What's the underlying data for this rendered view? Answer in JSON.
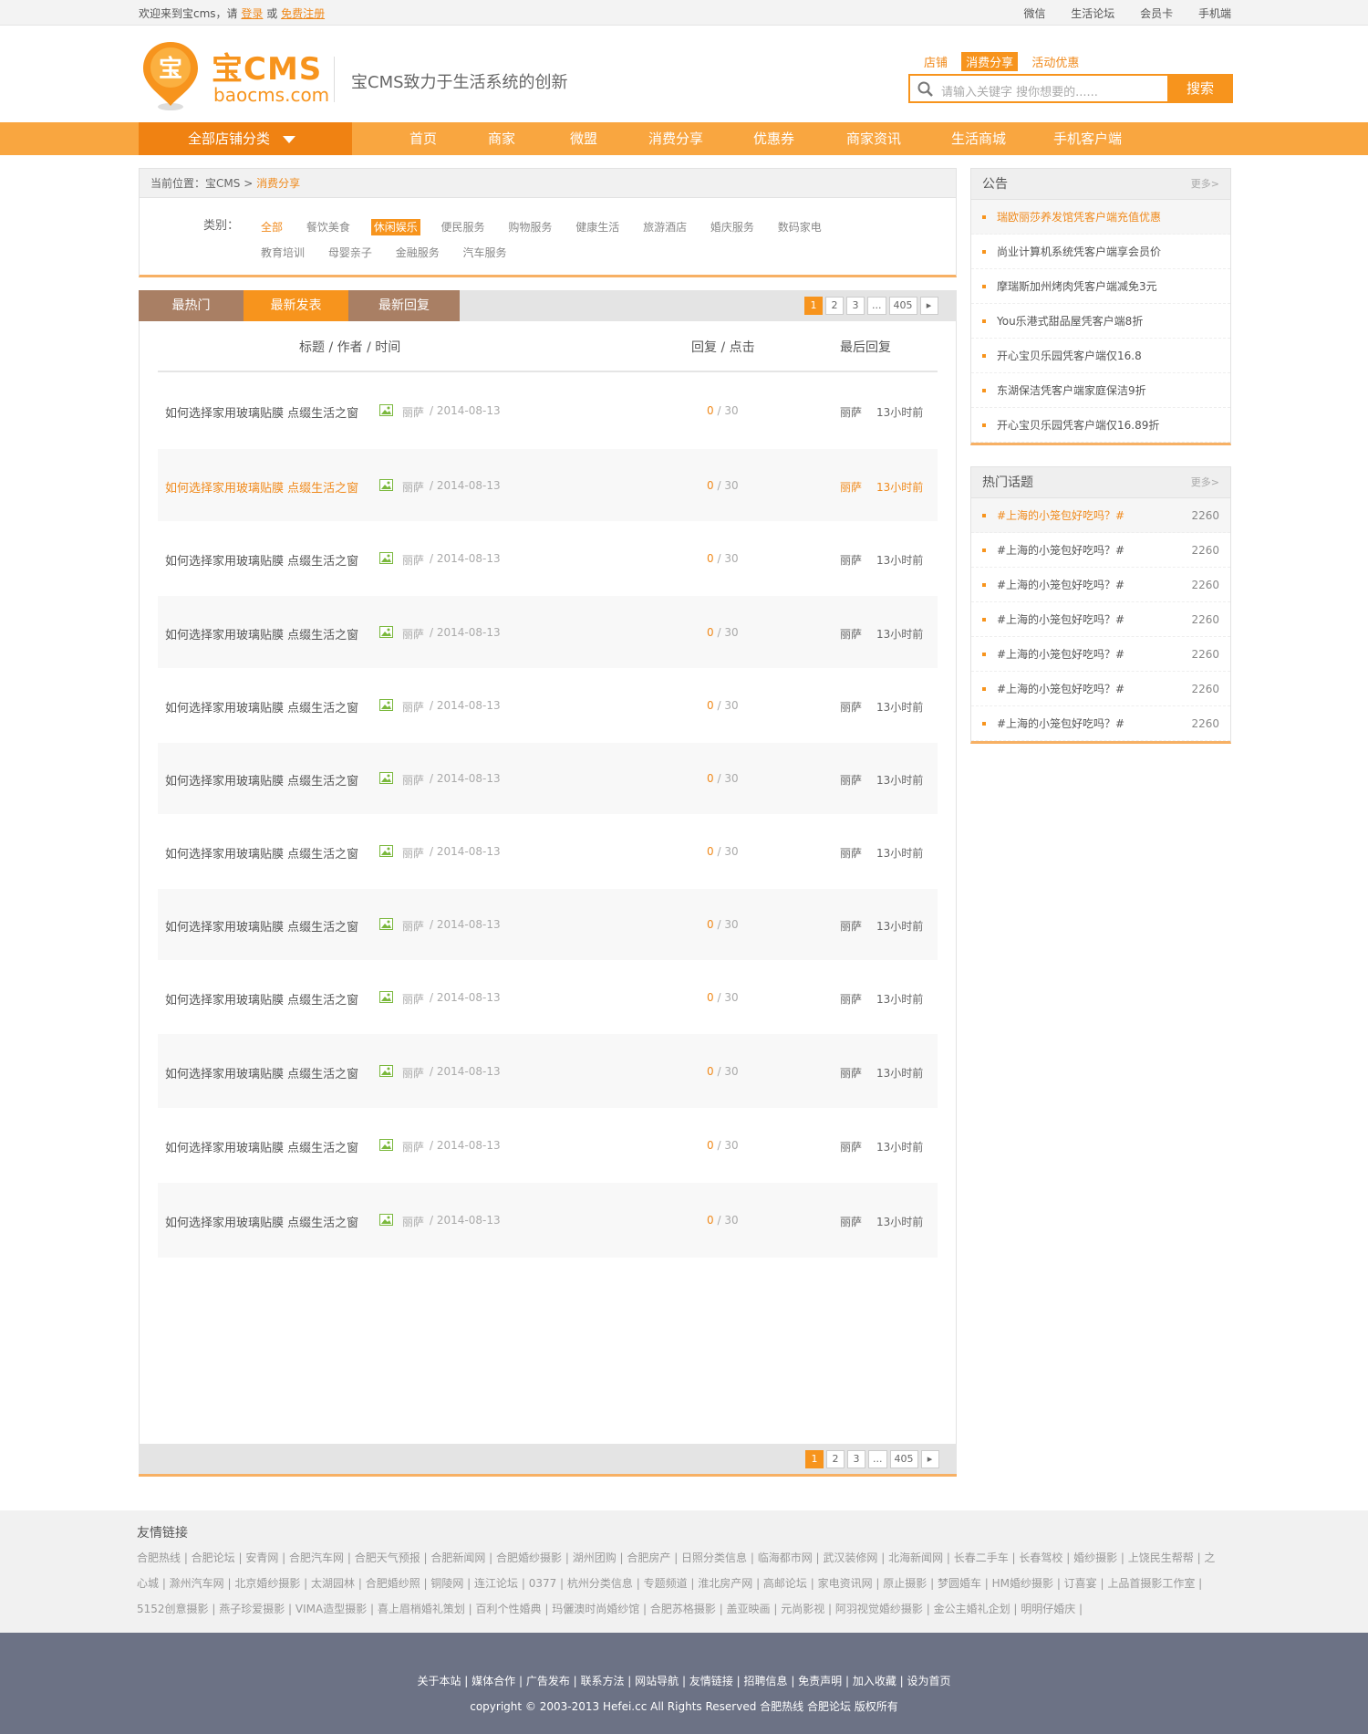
{
  "topbar": {
    "welcome": "欢迎来到宝cms，请",
    "login": "登录",
    "or": "或",
    "register": "免费注册",
    "right_links": [
      "微信",
      "生活论坛",
      "会员卡",
      "手机端"
    ]
  },
  "logo": {
    "brand": "宝CMS",
    "domain": "baocms.com",
    "mark": "宝"
  },
  "slogan": "宝CMS致力于生活系统的创新",
  "search": {
    "tabs": [
      "店铺",
      "消费分享",
      "活动优惠"
    ],
    "active_tab": "消费分享",
    "placeholder": "请输入关键字 搜你想要的......",
    "button": "搜索"
  },
  "nav": {
    "category_label": "全部店铺分类",
    "items": [
      "首页",
      "商家",
      "微盟",
      "消费分享",
      "优惠券",
      "商家资讯",
      "生活商城",
      "手机客户端"
    ]
  },
  "breadcrumb": {
    "prefix": "当前位置：宝CMS",
    "sep": ">",
    "current": "消费分享"
  },
  "categories": {
    "label": "类别：",
    "items": [
      "全部",
      "餐饮美食",
      "休闲娱乐",
      "便民服务",
      "购物服务",
      "健康生活",
      "旅游酒店",
      "婚庆服务",
      "数码家电",
      "教育培训",
      "母婴亲子",
      "金融服务",
      "汽车服务"
    ],
    "active": "休闲娱乐"
  },
  "tabs": [
    "最热门",
    "最新发表",
    "最新回复"
  ],
  "active_tab": "最新发表",
  "pager": {
    "pages": [
      "1",
      "2",
      "3",
      "...",
      "405"
    ],
    "current": "1",
    "next": "▸"
  },
  "list_header": {
    "title": "标题 / 作者 / 时间",
    "stats": "回复 / 点击",
    "last": "最后回复"
  },
  "threads": [
    {
      "title": "如何选择家用玻璃贴膜 点缀生活之窗",
      "author": "丽萨",
      "date": "/ 2014-08-13",
      "replies": "0",
      "clicks": "/ 30",
      "last_user": "丽萨",
      "last_time": "13小时前"
    },
    {
      "title": "如何选择家用玻璃贴膜 点缀生活之窗",
      "author": "丽萨",
      "date": "/ 2014-08-13",
      "replies": "0",
      "clicks": "/ 30",
      "last_user": "丽萨",
      "last_time": "13小时前"
    },
    {
      "title": "如何选择家用玻璃贴膜 点缀生活之窗",
      "author": "丽萨",
      "date": "/ 2014-08-13",
      "replies": "0",
      "clicks": "/ 30",
      "last_user": "丽萨",
      "last_time": "13小时前"
    },
    {
      "title": "如何选择家用玻璃贴膜 点缀生活之窗",
      "author": "丽萨",
      "date": "/ 2014-08-13",
      "replies": "0",
      "clicks": "/ 30",
      "last_user": "丽萨",
      "last_time": "13小时前"
    },
    {
      "title": "如何选择家用玻璃贴膜 点缀生活之窗",
      "author": "丽萨",
      "date": "/ 2014-08-13",
      "replies": "0",
      "clicks": "/ 30",
      "last_user": "丽萨",
      "last_time": "13小时前"
    },
    {
      "title": "如何选择家用玻璃贴膜 点缀生活之窗",
      "author": "丽萨",
      "date": "/ 2014-08-13",
      "replies": "0",
      "clicks": "/ 30",
      "last_user": "丽萨",
      "last_time": "13小时前"
    },
    {
      "title": "如何选择家用玻璃贴膜 点缀生活之窗",
      "author": "丽萨",
      "date": "/ 2014-08-13",
      "replies": "0",
      "clicks": "/ 30",
      "last_user": "丽萨",
      "last_time": "13小时前"
    },
    {
      "title": "如何选择家用玻璃贴膜 点缀生活之窗",
      "author": "丽萨",
      "date": "/ 2014-08-13",
      "replies": "0",
      "clicks": "/ 30",
      "last_user": "丽萨",
      "last_time": "13小时前"
    },
    {
      "title": "如何选择家用玻璃贴膜 点缀生活之窗",
      "author": "丽萨",
      "date": "/ 2014-08-13",
      "replies": "0",
      "clicks": "/ 30",
      "last_user": "丽萨",
      "last_time": "13小时前"
    },
    {
      "title": "如何选择家用玻璃贴膜 点缀生活之窗",
      "author": "丽萨",
      "date": "/ 2014-08-13",
      "replies": "0",
      "clicks": "/ 30",
      "last_user": "丽萨",
      "last_time": "13小时前"
    },
    {
      "title": "如何选择家用玻璃贴膜 点缀生活之窗",
      "author": "丽萨",
      "date": "/ 2014-08-13",
      "replies": "0",
      "clicks": "/ 30",
      "last_user": "丽萨",
      "last_time": "13小时前"
    },
    {
      "title": "如何选择家用玻璃贴膜 点缀生活之窗",
      "author": "丽萨",
      "date": "/ 2014-08-13",
      "replies": "0",
      "clicks": "/ 30",
      "last_user": "丽萨",
      "last_time": "13小时前"
    }
  ],
  "notice": {
    "title": "公告",
    "more": "更多>",
    "items": [
      "瑞欧丽莎养发馆凭客户端充值优惠",
      "尚业计算机系统凭客户端享会员价",
      "摩瑞斯加州烤肉凭客户端减免3元",
      "You乐港式甜品屋凭客户端8折",
      "开心宝贝乐园凭客户端仅16.8",
      "东湖保洁凭客户端家庭保洁9折",
      "开心宝贝乐园凭客户端仅16.89折"
    ]
  },
  "hot_topics": {
    "title": "热门话题",
    "more": "更多>",
    "items": [
      {
        "text": "#上海的小笼包好吃吗？#",
        "count": "2260"
      },
      {
        "text": "#上海的小笼包好吃吗？#",
        "count": "2260"
      },
      {
        "text": "#上海的小笼包好吃吗？#",
        "count": "2260"
      },
      {
        "text": "#上海的小笼包好吃吗？#",
        "count": "2260"
      },
      {
        "text": "#上海的小笼包好吃吗？#",
        "count": "2260"
      },
      {
        "text": "#上海的小笼包好吃吗？#",
        "count": "2260"
      },
      {
        "text": "#上海的小笼包好吃吗？#",
        "count": "2260"
      }
    ]
  },
  "friend_links": {
    "title": "友情链接",
    "text": "合肥热线 | 合肥论坛 | 安青网 | 合肥汽车网 | 合肥天气预报 | 合肥新闻网 | 合肥婚纱摄影 | 湖州团购 | 合肥房产 | 日照分类信息 | 临海都市网 | 武汉装修网 | 北海新闻网 | 长春二手车 | 长春驾校 | 婚纱摄影 | 上饶民生帮帮 | 之心城 | 滁州汽车网 | 北京婚纱摄影 | 太湖园林 | 合肥婚纱照 | 铜陵网 | 连江论坛 | 0377 | 杭州分类信息 | 专题频道 | 淮北房产网 | 高邮论坛 | 家电资讯网 | 原止摄影 | 梦圆婚车 | HM婚纱摄影 | 订喜宴 | 上品首摄影工作室 | 5152创意摄影 | 燕子珍爱摄影 | VIMA造型摄影 | 喜上眉梢婚礼策划 | 百利个性婚典 | 玛儷澳时尚婚纱馆 | 合肥苏格摄影 | 盖亚映画 | 元尚影视 | 阿羽视觉婚纱摄影 | 金公主婚礼企划 | 明明仔婚庆 |"
  },
  "footer": {
    "links": "关于本站 | 媒体合作 | 广告发布 | 联系方法 | 网站导航 | 友情链接 | 招聘信息 | 免责声明 | 加入收藏 | 设为首页",
    "copyright": "copyright © 2003-2013 Hefei.cc All Rights Reserved 合肥热线 合肥论坛 版权所有"
  },
  "colors": {
    "accent": "#f7941d",
    "nav_bg": "#f9a640",
    "tab_brown": "#a97f64",
    "footer_bg": "#6c7285"
  }
}
